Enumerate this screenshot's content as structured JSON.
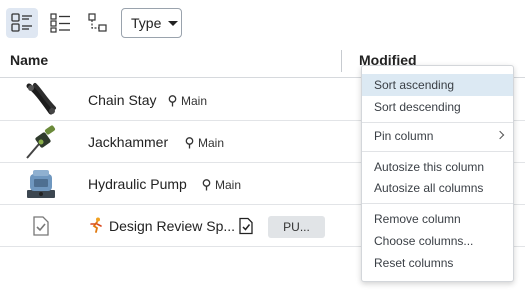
{
  "toolbar": {
    "views": [
      {
        "icon": "list-details-icon",
        "active": true
      },
      {
        "icon": "checklist-icon",
        "active": false
      },
      {
        "icon": "hierarchy-icon",
        "active": false
      }
    ],
    "type_filter_label": "Type"
  },
  "columns": {
    "name": "Name",
    "modified": "Modified"
  },
  "rows": [
    {
      "name": "Chain Stay",
      "branch": "Main",
      "thumb": "chain-stay-part-icon"
    },
    {
      "name": "Jackhammer",
      "branch": "Main",
      "thumb": "jackhammer-part-icon"
    },
    {
      "name": "Hydraulic Pump",
      "branch": "Main",
      "thumb": "hydraulic-pump-part-icon"
    },
    {
      "name": "Design Review Sp...",
      "branch": "",
      "thumb": "document-check-icon",
      "publication_chip": "PU..."
    }
  ],
  "context_menu": {
    "groups": [
      [
        {
          "label": "Sort ascending",
          "highlighted": true
        },
        {
          "label": "Sort descending"
        }
      ],
      [
        {
          "label": "Pin column",
          "submenu": true
        }
      ],
      [
        {
          "label": "Autosize this column"
        },
        {
          "label": "Autosize all columns"
        }
      ],
      [
        {
          "label": "Remove column"
        },
        {
          "label": "Choose columns..."
        },
        {
          "label": "Reset columns"
        }
      ]
    ]
  },
  "colors": {
    "accent_highlight": "#dce9f3",
    "active_view_bg": "#dfe7f2",
    "text": "#222222"
  }
}
